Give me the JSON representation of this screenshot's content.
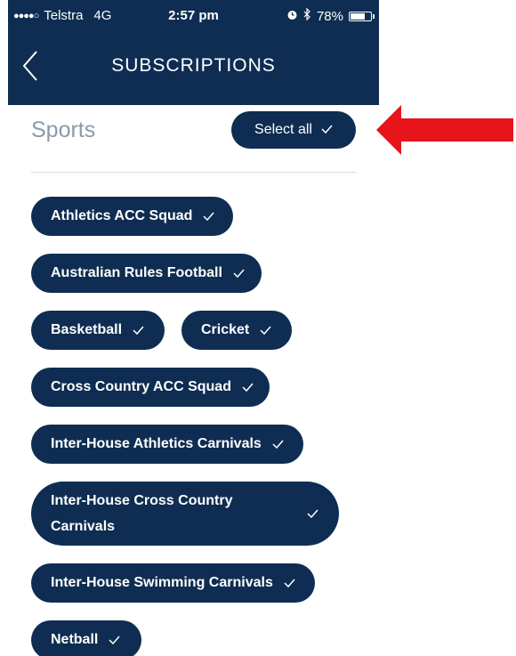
{
  "status_bar": {
    "signal": "●●●●○",
    "carrier": "Telstra",
    "network": "4G",
    "time": "2:57 pm",
    "alarm_icon": "alarm-icon",
    "bluetooth_icon": "bluetooth-icon",
    "battery_percent": "78%",
    "battery_level": 0.78
  },
  "nav": {
    "title": "SUBSCRIPTIONS",
    "back_icon": "chevron-left-icon"
  },
  "section": {
    "title": "Sports",
    "select_all_label": "Select all"
  },
  "chips": [
    {
      "label": "Athletics ACC Squad",
      "selected": true
    },
    {
      "label": "Australian Rules Football",
      "selected": true
    },
    {
      "label": "Basketball",
      "selected": true
    },
    {
      "label": "Cricket",
      "selected": true
    },
    {
      "label": "Cross Country ACC Squad",
      "selected": true
    },
    {
      "label": "Inter-House Athletics Carnivals",
      "selected": true
    },
    {
      "label": "Inter-House Cross Country Carnivals",
      "selected": true
    },
    {
      "label": "Inter-House Swimming Carnivals",
      "selected": true
    },
    {
      "label": "Netball",
      "selected": true
    }
  ],
  "colors": {
    "primary": "#0f2d52",
    "annotation_arrow": "#e8141b",
    "section_title": "#8a9aa8"
  }
}
